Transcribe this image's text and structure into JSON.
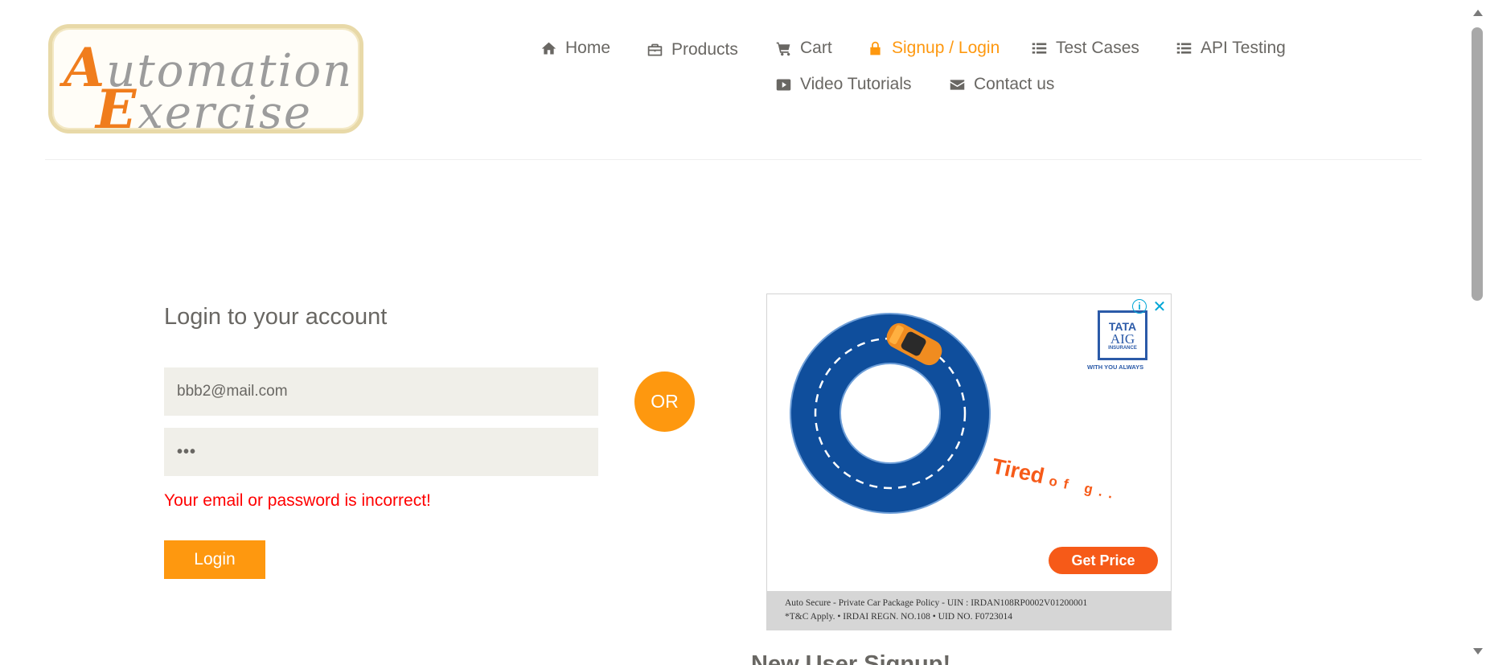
{
  "logo": {
    "line1_cap": "A",
    "line1_rest": "utomation",
    "line2_cap": "E",
    "line2_rest": "xercise"
  },
  "nav": {
    "items": [
      {
        "label": "Home",
        "icon": "home-icon"
      },
      {
        "label": "Products",
        "icon": "briefcase-icon"
      },
      {
        "label": "Cart",
        "icon": "cart-icon"
      },
      {
        "label": "Signup / Login",
        "icon": "lock-icon",
        "active": true
      },
      {
        "label": "Test Cases",
        "icon": "list-icon"
      },
      {
        "label": "API Testing",
        "icon": "list-icon"
      },
      {
        "label": "Video Tutorials",
        "icon": "youtube-play-icon"
      },
      {
        "label": "Contact us",
        "icon": "envelope-icon"
      }
    ]
  },
  "login": {
    "title": "Login to your account",
    "email_value": "bbb2@mail.com",
    "password_value": "•••",
    "error": "Your email or password is incorrect!",
    "button_label": "Login"
  },
  "divider_label": "OR",
  "ad": {
    "brand_line1": "TATA",
    "brand_line2": "AIG",
    "brand_line3": "INSURANCE",
    "tagline": "WITH YOU ALWAYS",
    "headline": "Tired",
    "headline_rest": "of g..",
    "cta": "Get Price",
    "footer_line1": "Auto Secure - Private Car Package Policy - UIN : IRDAN108RP0002V01200001",
    "footer_line2": "*T&C Apply.  •  IRDAI REGN. NO.108  •  UID NO. F0723014",
    "info_icon": "info-icon",
    "close_icon": "close-icon"
  },
  "signup": {
    "title": "New User Signup!"
  },
  "colors": {
    "accent": "#fe980f",
    "text": "#696763",
    "error": "#ff0000",
    "input_bg": "#f0efe9"
  }
}
